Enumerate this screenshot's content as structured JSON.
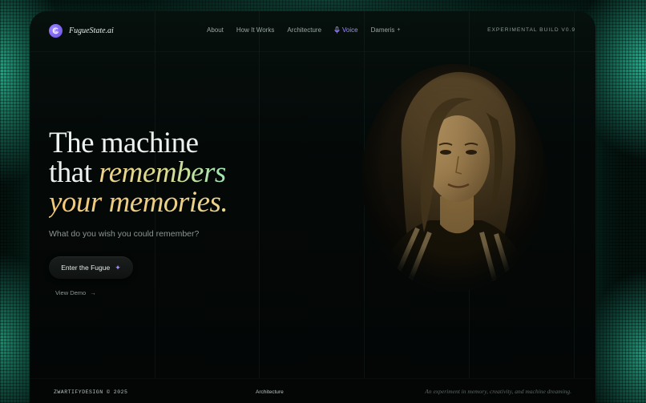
{
  "brand": {
    "name": "FugueState.ai",
    "logo_icon": "swirl-icon"
  },
  "nav": {
    "items": [
      {
        "label": "About"
      },
      {
        "label": "How It Works"
      },
      {
        "label": "Architecture"
      },
      {
        "label": "Voice",
        "active": true,
        "icon": "microphone-icon"
      },
      {
        "label": "Dameris",
        "icon": "plus-icon"
      }
    ]
  },
  "build_label": "EXPERIMENTAL BUILD V0.9",
  "hero": {
    "line1": "The machine",
    "line2_plain": "that ",
    "line2_italic": "remembers",
    "line3_italic": "your memories."
  },
  "subtitle": "What do you wish you could remember?",
  "cta": {
    "label": "Enter the Fugue",
    "icon": "sparkle-icon"
  },
  "demo_link": {
    "label": "View Demo",
    "icon": "arrow-right-icon"
  },
  "footer": {
    "left": "ZWARTIFYDESIGN © 2025",
    "middle": "Architecture",
    "right": "An experiment in memory, creativity, and machine dreaming."
  },
  "colors": {
    "accent": "#9d8cff",
    "gold": "#f0d38a",
    "glow": "#16b48c"
  }
}
